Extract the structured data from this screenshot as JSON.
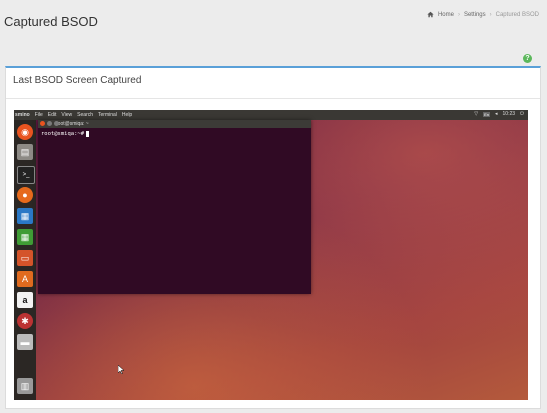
{
  "header": {
    "title": "Captured BSOD",
    "breadcrumb": [
      "Home",
      "Settings",
      "Captured BSOD"
    ]
  },
  "help": {
    "glyph": "?"
  },
  "panel": {
    "title": "Last BSOD Screen Captured"
  },
  "screenshot": {
    "topbar": {
      "menu": [
        "smino",
        "File",
        "Edit",
        "View",
        "Search",
        "Terminal",
        "Help"
      ],
      "keyboard": "En",
      "time": "10:23"
    },
    "terminal": {
      "title": "root@smiqa: ~",
      "prompt": "root@smiqa:~#"
    },
    "launcher_icons": [
      "ubuntu-dash-icon",
      "files-icon",
      "terminal-icon",
      "firefox-icon",
      "writer-icon",
      "calc-icon",
      "impress-icon",
      "software-center-icon",
      "amazon-icon",
      "settings-icon",
      "drive-icon",
      "trash-icon"
    ]
  },
  "colors": {
    "accent": "#5aa0d8",
    "help": "#5cb85c",
    "terminal_bg": "#300a24"
  }
}
